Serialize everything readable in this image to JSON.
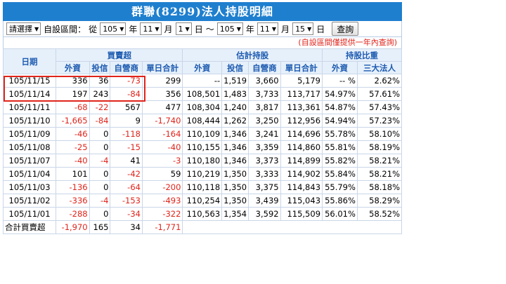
{
  "title": "群聯(8299)法人持股明細",
  "filter": {
    "preset": "請選擇",
    "custom_label": "自設區間：",
    "from_label": "從",
    "start_year": "105",
    "start_month": "11",
    "start_day": "1",
    "tilde": "～",
    "end_year": "105",
    "end_month": "11",
    "end_day": "15",
    "year_unit": "年",
    "month_unit": "月",
    "day_unit": "日",
    "query_button": "查詢"
  },
  "note": "(自設區間僅提供一年內查詢)",
  "table": {
    "group_headers": [
      "日期",
      "買賣超",
      "估計持股",
      "持股比重"
    ],
    "sub_headers": [
      "外資",
      "投信",
      "自營商",
      "單日合計",
      "外資",
      "投信",
      "自營商",
      "單日合計",
      "外資",
      "三大法人"
    ],
    "rows": [
      [
        "105/11/15",
        "336",
        "36",
        "-73",
        "299",
        "--",
        "1,519",
        "3,660",
        "5,179",
        "-- %",
        "2.62%"
      ],
      [
        "105/11/14",
        "197",
        "243",
        "-84",
        "356",
        "108,501",
        "1,483",
        "3,733",
        "113,717",
        "54.97%",
        "57.61%"
      ],
      [
        "105/11/11",
        "-68",
        "-22",
        "567",
        "477",
        "108,304",
        "1,240",
        "3,817",
        "113,361",
        "54.87%",
        "57.43%"
      ],
      [
        "105/11/10",
        "-1,665",
        "-84",
        "9",
        "-1,740",
        "108,444",
        "1,262",
        "3,250",
        "112,956",
        "54.94%",
        "57.23%"
      ],
      [
        "105/11/09",
        "-46",
        "0",
        "-118",
        "-164",
        "110,109",
        "1,346",
        "3,241",
        "114,696",
        "55.78%",
        "58.10%"
      ],
      [
        "105/11/08",
        "-25",
        "0",
        "-15",
        "-40",
        "110,155",
        "1,346",
        "3,359",
        "114,860",
        "55.81%",
        "58.19%"
      ],
      [
        "105/11/07",
        "-40",
        "-4",
        "41",
        "-3",
        "110,180",
        "1,346",
        "3,373",
        "114,899",
        "55.82%",
        "58.21%"
      ],
      [
        "105/11/04",
        "101",
        "0",
        "-42",
        "59",
        "110,219",
        "1,350",
        "3,333",
        "114,902",
        "55.84%",
        "58.21%"
      ],
      [
        "105/11/03",
        "-136",
        "0",
        "-64",
        "-200",
        "110,118",
        "1,350",
        "3,375",
        "114,843",
        "55.79%",
        "58.18%"
      ],
      [
        "105/11/02",
        "-336",
        "-4",
        "-153",
        "-493",
        "110,254",
        "1,350",
        "3,439",
        "115,043",
        "55.86%",
        "58.29%"
      ],
      [
        "105/11/01",
        "-288",
        "0",
        "-34",
        "-322",
        "110,563",
        "1,354",
        "3,592",
        "115,509",
        "56.01%",
        "58.52%"
      ]
    ],
    "total_row": [
      "合計買賣超",
      "-1,970",
      "165",
      "34",
      "-1,771"
    ]
  },
  "colors": {
    "header_bg": "#1f7fcf",
    "negative": "#e0241b",
    "header_text": "#1c5ab0",
    "highlight": "#e0241b"
  }
}
